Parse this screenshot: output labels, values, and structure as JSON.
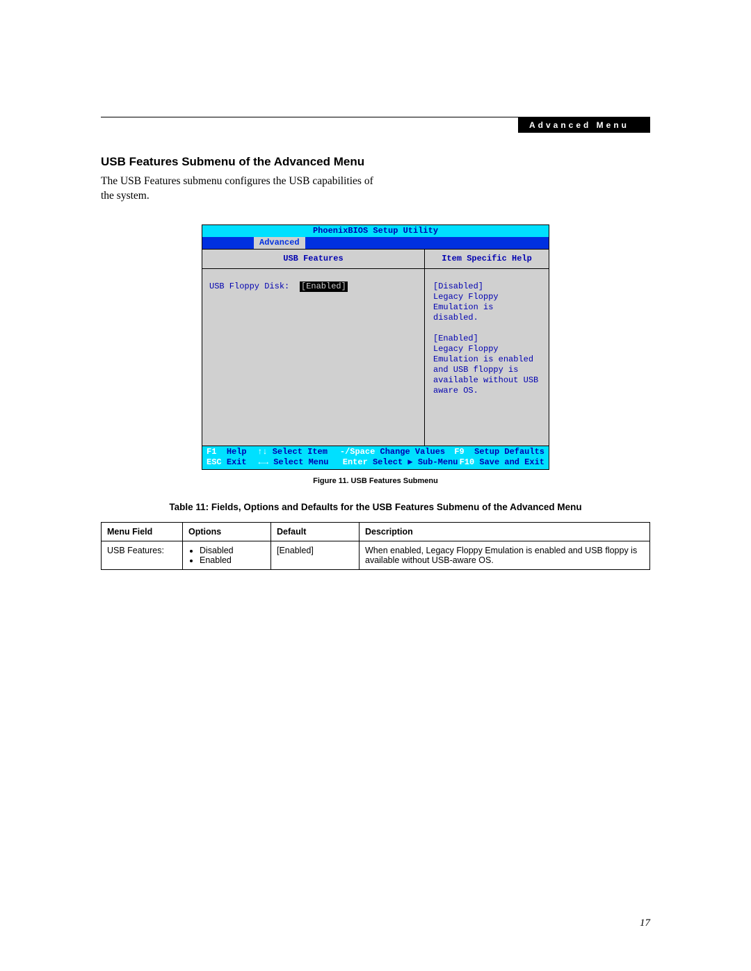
{
  "header": {
    "tag": "Advanced Menu"
  },
  "section": {
    "title": "USB Features Submenu of the Advanced Menu",
    "intro": "The USB Features submenu configures the USB capabilities of the system."
  },
  "bios": {
    "title": "PhoenixBIOS Setup Utility",
    "tab": "Advanced",
    "left_title": "USB Features",
    "right_title": "Item Specific Help",
    "field_label": "USB Floppy Disk:",
    "field_value": "[Enabled]",
    "help_text": "[Disabled]\nLegacy Floppy Emulation is disabled.\n\n[Enabled]\nLegacy Floppy Emulation is enabled and USB floppy is available without USB aware OS.",
    "footer": {
      "r1c1_key": "F1",
      "r1c1_label": "Help",
      "r1c2_key": "↑↓",
      "r1c2_label": "Select Item",
      "r1c3_key": "-/Space",
      "r1c3_label": "Change Values",
      "r1c4_key": "F9",
      "r1c4_label": "Setup Defaults",
      "r2c1_key": "ESC",
      "r2c1_label": "Exit",
      "r2c2_key": "←→",
      "r2c2_label": "Select Menu",
      "r2c3_key": "Enter",
      "r2c3_label": "Select ▶ Sub-Menu",
      "r2c4_key": "F10",
      "r2c4_label": "Save and Exit"
    }
  },
  "figure_caption": "Figure 11.  USB Features Submenu",
  "table_caption": "Table 11: Fields, Options and Defaults for the USB Features Submenu of the Advanced Menu",
  "table": {
    "headers": {
      "menu_field": "Menu Field",
      "options": "Options",
      "default": "Default",
      "description": "Description"
    },
    "row": {
      "menu_field": "USB Features:",
      "option1": "Disabled",
      "option2": "Enabled",
      "default": "[Enabled]",
      "description": "When enabled, Legacy Floppy Emulation is enabled and USB floppy is available without USB-aware OS."
    }
  },
  "page_number": "17"
}
